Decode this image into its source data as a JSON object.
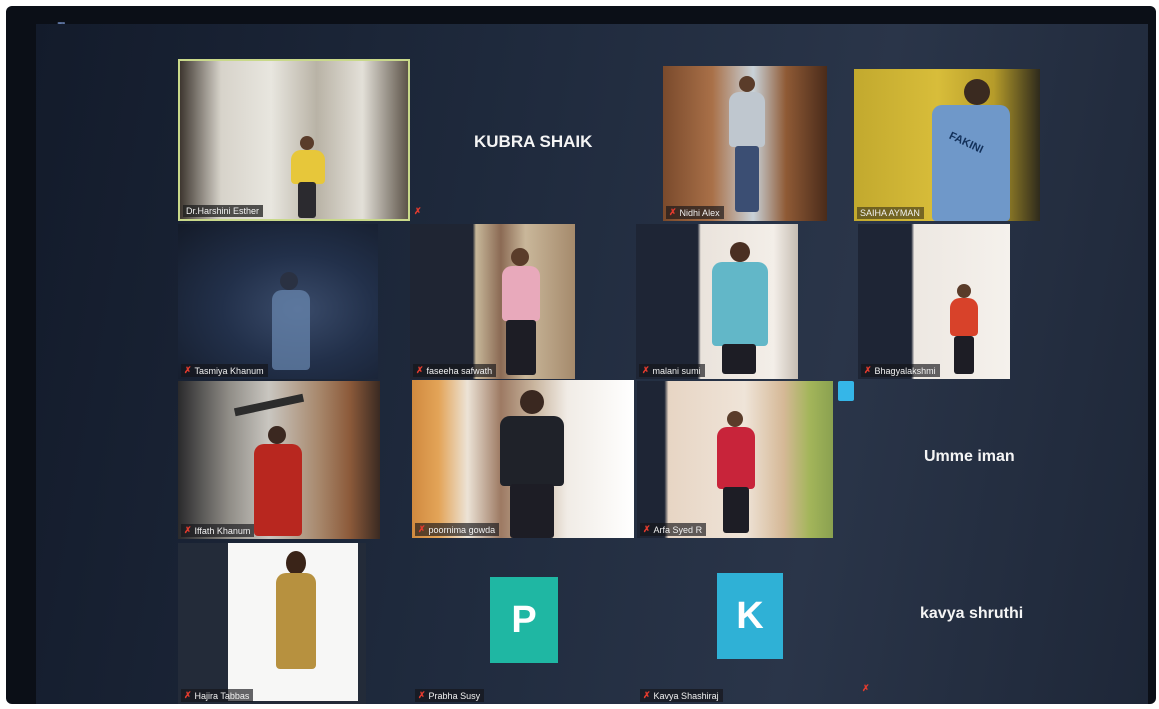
{
  "participants": {
    "harshini": "Dr.Harshini Esther",
    "kubra": "KUBRA SHAIK",
    "nidhi": "Nidhi Alex",
    "saiha": "SAIHA AYMAN",
    "tasmiya": "Tasmiya Khanum",
    "faseeha": "faseeha safwath",
    "malani": "malani sumi",
    "bhagyalakshmi": "Bhagyalakshmi",
    "iffath": "Iffath Khanum",
    "poornima": "poornima gowda",
    "arfa": "Arfa Syed R",
    "umme": "Umme iman",
    "hajira": "Hajira Tabbas",
    "prabha": "Prabha Susy",
    "prabha_initial": "P",
    "kavya_s": "Kavya Shashiraj",
    "kavya_initial": "K",
    "kavya_shruthi": "kavya shruthi"
  },
  "shirt_text": "FAKINI",
  "icons": {
    "mic_muted": "mic-muted-icon"
  },
  "colors": {
    "active_border": "#c9d98a",
    "avatar_teal": "#1fb7a3",
    "avatar_cyan": "#2fb1d6",
    "mute_red": "#e23b2e"
  }
}
